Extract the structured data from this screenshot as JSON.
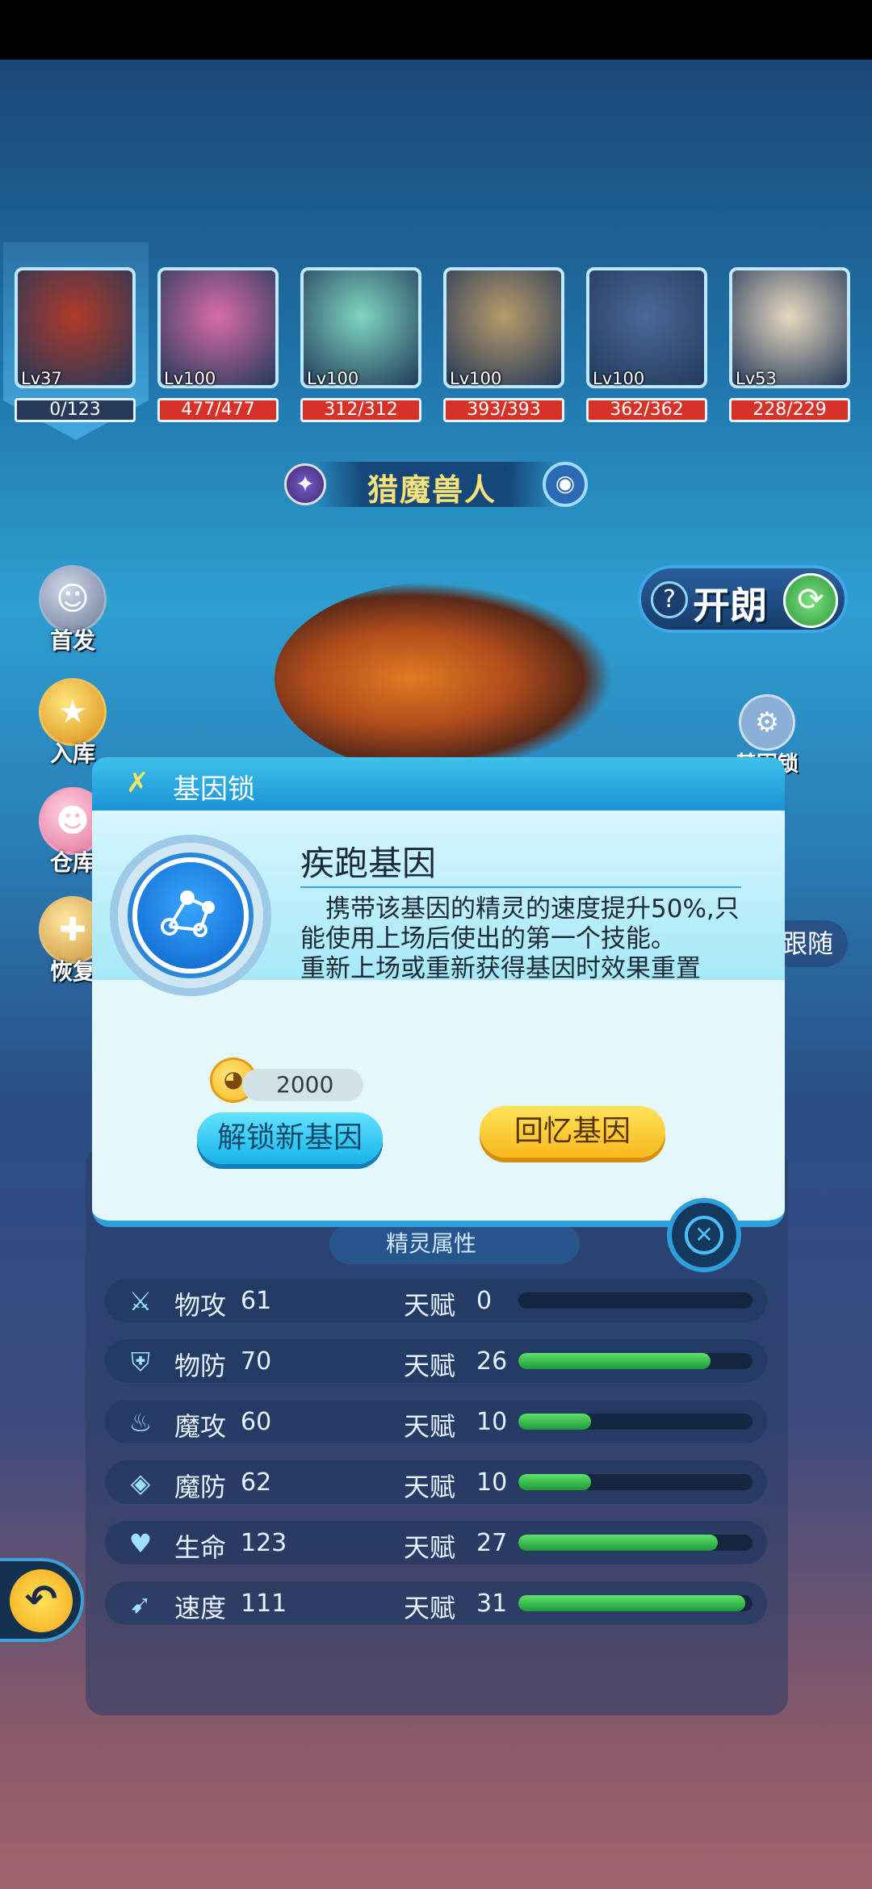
{
  "team": [
    {
      "level": "Lv37",
      "hp": "0/123",
      "hp_style": "dark",
      "color": "#b13a2a"
    },
    {
      "level": "Lv100",
      "hp": "477/477",
      "hp_style": "red",
      "color": "#d86ca8"
    },
    {
      "level": "Lv100",
      "hp": "312/312",
      "hp_style": "red",
      "color": "#7dd6c0"
    },
    {
      "level": "Lv100",
      "hp": "393/393",
      "hp_style": "red",
      "color": "#b89a6a"
    },
    {
      "level": "Lv100",
      "hp": "362/362",
      "hp_style": "red",
      "color": "#4a6a9a"
    },
    {
      "level": "Lv53",
      "hp": "228/229",
      "hp_style": "red",
      "color": "#e8d8c0"
    }
  ],
  "creature_name": "猎魔兽人",
  "side_buttons": {
    "first": "首发",
    "store": "入库",
    "warehouse": "仓库",
    "recover": "恢复"
  },
  "kailang_label": "开朗",
  "gene_lock_side_label": "基因锁",
  "follow_label": "跟随",
  "attr_tab_label": "精灵属性",
  "stats": [
    {
      "icon": "sword-icon",
      "name": "物攻",
      "value": "61",
      "talent_label": "天赋",
      "talent": "0",
      "fill": 0
    },
    {
      "icon": "shield-icon",
      "name": "物防",
      "value": "70",
      "talent_label": "天赋",
      "talent": "26",
      "fill": 0.82
    },
    {
      "icon": "flame-icon",
      "name": "魔攻",
      "value": "60",
      "talent_label": "天赋",
      "talent": "10",
      "fill": 0.31
    },
    {
      "icon": "magic-shield-icon",
      "name": "魔防",
      "value": "62",
      "talent_label": "天赋",
      "talent": "10",
      "fill": 0.31
    },
    {
      "icon": "heart-icon",
      "name": "生命",
      "value": "123",
      "talent_label": "天赋",
      "talent": "27",
      "fill": 0.85
    },
    {
      "icon": "boot-icon",
      "name": "速度",
      "value": "111",
      "talent_label": "天赋",
      "talent": "31",
      "fill": 0.97
    }
  ],
  "dialog": {
    "title": "基因锁",
    "gene_name": "疾跑基因",
    "description": "　携带该基因的精灵的速度提升50%,只能使用上场后使出的第一个技能。\n重新上场或重新获得基因时效果重置",
    "cost": "2000",
    "unlock_label": "解锁新基因",
    "recall_label": "回忆基因"
  }
}
